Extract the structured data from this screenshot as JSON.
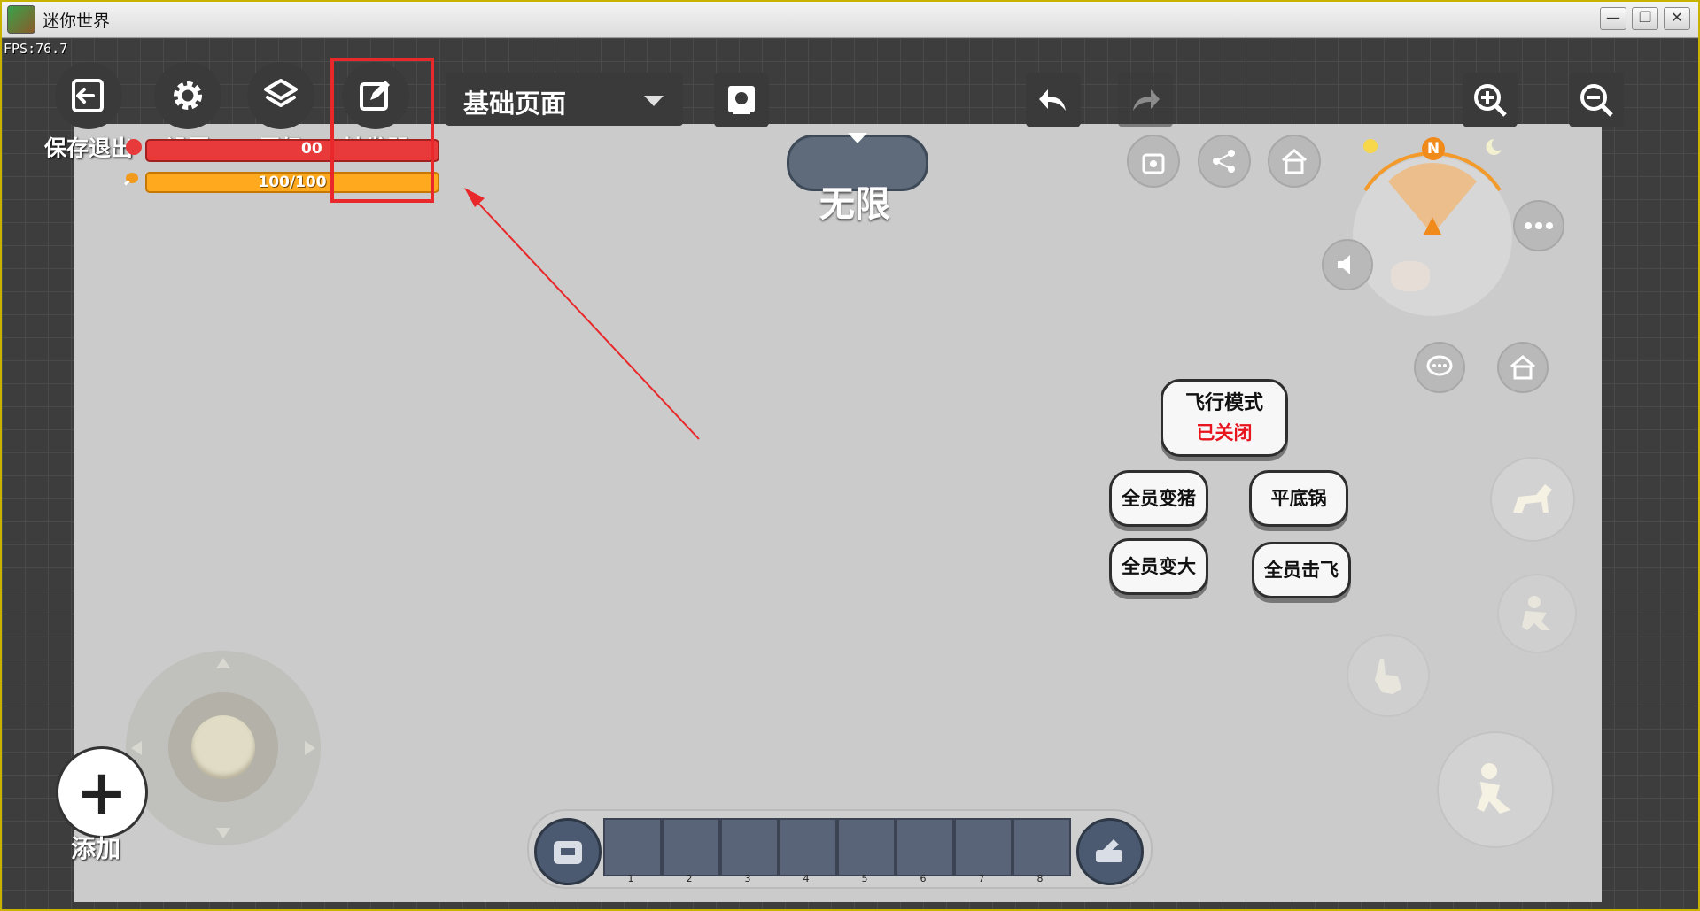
{
  "window": {
    "title": "迷你世界",
    "minimize": "—",
    "restore": "❐",
    "close": "✕"
  },
  "fps": "FPS:76.7",
  "toolbar": {
    "items": [
      {
        "label": "保存退出",
        "icon": "exit-icon"
      },
      {
        "label": "设置",
        "icon": "gear-icon"
      },
      {
        "label": "层级",
        "icon": "layers-icon"
      },
      {
        "label": "触发器",
        "icon": "edit-icon"
      }
    ],
    "page_select": "基础页面"
  },
  "status": {
    "health_text": "00",
    "hunger_text": "100/100"
  },
  "mode_label": "无限",
  "fly_mode": {
    "title": "飞行模式",
    "state": "已关闭"
  },
  "action_buttons": [
    "全员变猪",
    "平底锅",
    "全员变大",
    "全员击飞"
  ],
  "compass": {
    "north": "N"
  },
  "add": {
    "symbol": "+",
    "label": "添加"
  },
  "hotbar": {
    "slots": [
      "1",
      "2",
      "3",
      "4",
      "5",
      "6",
      "7",
      "8"
    ]
  },
  "colors": {
    "highlight": "#e8282a",
    "health": "#e83a3a",
    "hunger": "#ffa91e",
    "fly_off": "#e8141e"
  }
}
